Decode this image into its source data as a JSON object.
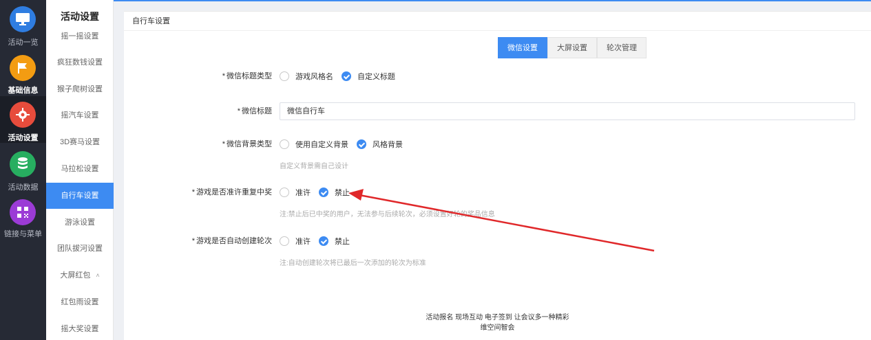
{
  "rail": {
    "items": [
      {
        "label": "活动一览",
        "icon": "monitor-icon",
        "color": "#2f7de1"
      },
      {
        "label": "基础信息",
        "icon": "flag-icon",
        "color": "#f39c12"
      },
      {
        "label": "活动设置",
        "icon": "gear-icon",
        "color": "#e74c3c"
      },
      {
        "label": "活动数据",
        "icon": "database-icon",
        "color": "#27ae60"
      },
      {
        "label": "链接与菜单",
        "icon": "qrcode-icon",
        "color": "#9b3bd6"
      }
    ]
  },
  "submenu": {
    "title": "活动设置",
    "items": [
      "摇一摇设置",
      "疯狂数钱设置",
      "猴子爬树设置",
      "摇汽车设置",
      "3D赛马设置",
      "马拉松设置",
      "自行车设置",
      "游泳设置",
      "团队拔河设置",
      "大屏红包",
      "红包雨设置",
      "摇大奖设置"
    ],
    "active_index": 6
  },
  "card": {
    "header": "自行车设置",
    "tabs": [
      "微信设置",
      "大屏设置",
      "轮次管理"
    ],
    "active_tab": 0
  },
  "form": {
    "title_type": {
      "label": "微信标题类型",
      "options": [
        "游戏风格名",
        "自定义标题"
      ],
      "selected": 1
    },
    "title": {
      "label": "微信标题",
      "value": "微信自行车"
    },
    "bg_type": {
      "label": "微信背景类型",
      "options": [
        "使用自定义背景",
        "风格背景"
      ],
      "selected": 1,
      "hint": "自定义背景需自己设计"
    },
    "repeat_win": {
      "label": "游戏是否准许重复中奖",
      "options": [
        "准许",
        "禁止"
      ],
      "selected": 1,
      "hint": "注:禁止后已中奖的用户，无法参与后续轮次，必须设置好轮的奖品信息"
    },
    "auto_round": {
      "label": "游戏是否自动创建轮次",
      "options": [
        "准许",
        "禁止"
      ],
      "selected": 1,
      "hint": "注:自动创建轮次将已最后一次添加的轮次为标准"
    }
  },
  "footer": {
    "line1": "活动报名 现场互动 电子签到 让会议多一种精彩",
    "line2": "维空间智会"
  },
  "colors": {
    "accent": "#3d8bf2",
    "annotation_arrow": "#e0282a"
  }
}
